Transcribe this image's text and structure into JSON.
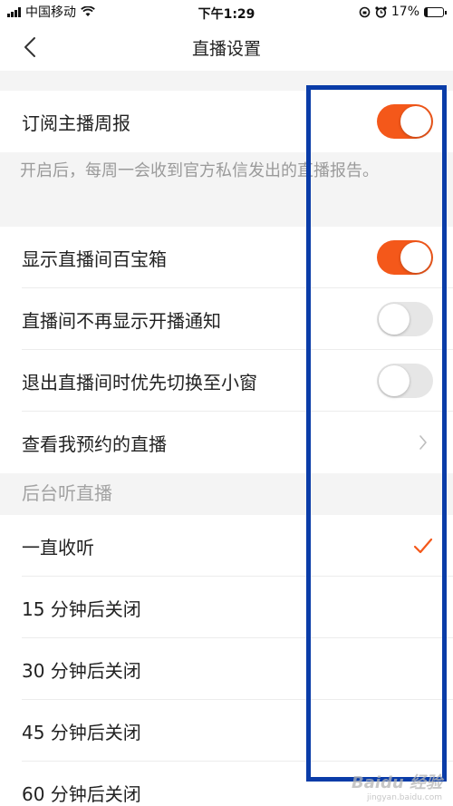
{
  "status": {
    "carrier": "中国移动",
    "time": "下午1:29",
    "battery": "17%",
    "battery_level": 0.17
  },
  "nav": {
    "title": "直播设置",
    "back_icon": "chevron-left-icon"
  },
  "settings": {
    "weekly_report": {
      "label": "订阅主播周报",
      "on": true
    },
    "weekly_report_note": "开启后，每周一会收到官方私信发出的直播报告。",
    "treasure_box": {
      "label": "显示直播间百宝箱",
      "on": true
    },
    "hide_start_notice": {
      "label": "直播间不再显示开播通知",
      "on": false
    },
    "mini_window": {
      "label": "退出直播间时优先切换至小窗",
      "on": false
    },
    "my_reservations": {
      "label": "查看我预约的直播"
    }
  },
  "background_listen": {
    "header": "后台听直播",
    "options": [
      {
        "label": "一直收听",
        "selected": true
      },
      {
        "label": "15 分钟后关闭",
        "selected": false
      },
      {
        "label": "30 分钟后关闭",
        "selected": false
      },
      {
        "label": "45 分钟后关闭",
        "selected": false
      },
      {
        "label": "60 分钟后关闭",
        "selected": false
      }
    ]
  },
  "colors": {
    "accent": "#f4581a",
    "highlight_box": "#0a3ca8"
  },
  "watermark": {
    "main": "Baidu 经验",
    "sub": "jingyan.baidu.com"
  }
}
